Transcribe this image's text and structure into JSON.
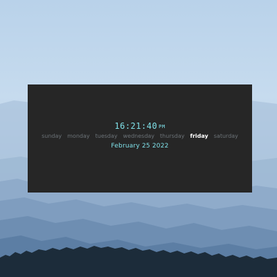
{
  "clock": {
    "time": "16:21:40",
    "ampm": "PM",
    "date": "February 25 2022",
    "days": [
      {
        "label": "sunday",
        "active": false
      },
      {
        "label": "monday",
        "active": false
      },
      {
        "label": "tuesday",
        "active": false
      },
      {
        "label": "wednesday",
        "active": false
      },
      {
        "label": "thursday",
        "active": false
      },
      {
        "label": "friday",
        "active": true
      },
      {
        "label": "saturday",
        "active": false
      }
    ]
  },
  "colors": {
    "accent": "#7fe0e8",
    "panel": "#262626",
    "inactive_day": "#6c7378",
    "active_day": "#ffffff"
  }
}
